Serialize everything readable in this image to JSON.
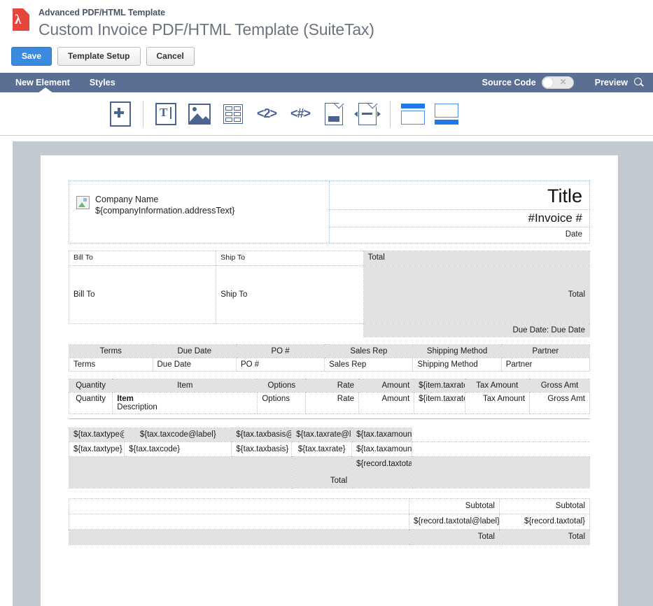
{
  "header": {
    "breadcrumb": "Advanced PDF/HTML Template",
    "title": "Custom Invoice PDF/HTML Template (SuiteTax)",
    "pdf_icon_glyph": "λ",
    "buttons": {
      "save": "Save",
      "template_setup": "Template Setup",
      "cancel": "Cancel"
    }
  },
  "tabbar": {
    "tabs": [
      {
        "label": "New Element",
        "active": true
      },
      {
        "label": "Styles",
        "active": false
      }
    ],
    "source_code_label": "Source Code",
    "source_code_state": "off",
    "toggle_glyph": "✕",
    "preview_label": "Preview",
    "accent": "#5b6e93"
  },
  "toolbar": {
    "items": [
      {
        "name": "add-element-icon",
        "tip": "Add Element"
      },
      {
        "name": "text-element-icon",
        "tip": "Text"
      },
      {
        "name": "image-element-icon",
        "tip": "Image"
      },
      {
        "name": "table-element-icon",
        "tip": "Table"
      },
      {
        "name": "page-number-icon",
        "tip": "Page Number",
        "glyph": "<2>"
      },
      {
        "name": "field-code-icon",
        "tip": "Field",
        "glyph": "<#>"
      },
      {
        "name": "footer-icon",
        "tip": "Footer"
      },
      {
        "name": "header-icon",
        "tip": "Header"
      },
      {
        "name": "band-top-icon",
        "tip": "Top Band"
      },
      {
        "name": "band-bottom-icon",
        "tip": "Bottom Band"
      }
    ]
  },
  "document": {
    "company": {
      "name_line": "Company Name",
      "address_line": "${companyInformation.addressText}"
    },
    "titleblock": {
      "title": "Title",
      "invoice_no": "#Invoice #",
      "date": "Date"
    },
    "addresses": {
      "bill_to_label": "Bill To",
      "bill_to_value": "Bill To",
      "ship_to_label": "Ship To",
      "ship_to_value": "Ship To",
      "total_label": "Total",
      "total_value": "Total",
      "due_date": "Due Date: Due Date"
    },
    "terms": {
      "headers": [
        "Terms",
        "Due Date",
        "PO #",
        "Sales Rep",
        "Shipping Method",
        "Partner"
      ],
      "values": [
        "Terms",
        "Due Date",
        "PO #",
        "Sales Rep",
        "Shipping Method",
        "Partner"
      ]
    },
    "items": {
      "headers": [
        "Quantity",
        "Item",
        "Options",
        "Rate",
        "Amount",
        "${item.taxrate@label}",
        "Tax Amount",
        "Gross Amt"
      ],
      "row": {
        "quantity": "Quantity",
        "item": "Item",
        "description": "Description",
        "options": "Options",
        "rate": "Rate",
        "amount": "Amount",
        "taxrate": "${item.taxrate}",
        "tax_amount": "Tax Amount",
        "gross_amt": "Gross Amt"
      }
    },
    "tax": {
      "headers": [
        "${tax.taxtype@label}",
        "${tax.taxcode@label}",
        "${tax.taxbasis@label}",
        "${tax.taxrate@label}",
        "${tax.taxamount@label}",
        ""
      ],
      "row": [
        "${tax.taxtype}",
        "${tax.taxcode}",
        "${tax.taxbasis}",
        "${tax.taxrate}",
        "${tax.taxamount}",
        ""
      ],
      "total_label": "Total",
      "total_value": "${record.taxtotal}"
    },
    "summary": [
      {
        "label": "Subtotal",
        "value": "Subtotal",
        "shaded": false
      },
      {
        "label": "${record.taxtotal@label}",
        "value": "${record.taxtotal}",
        "shaded": false
      },
      {
        "label": "Total",
        "value": "Total",
        "shaded": true
      }
    ]
  }
}
